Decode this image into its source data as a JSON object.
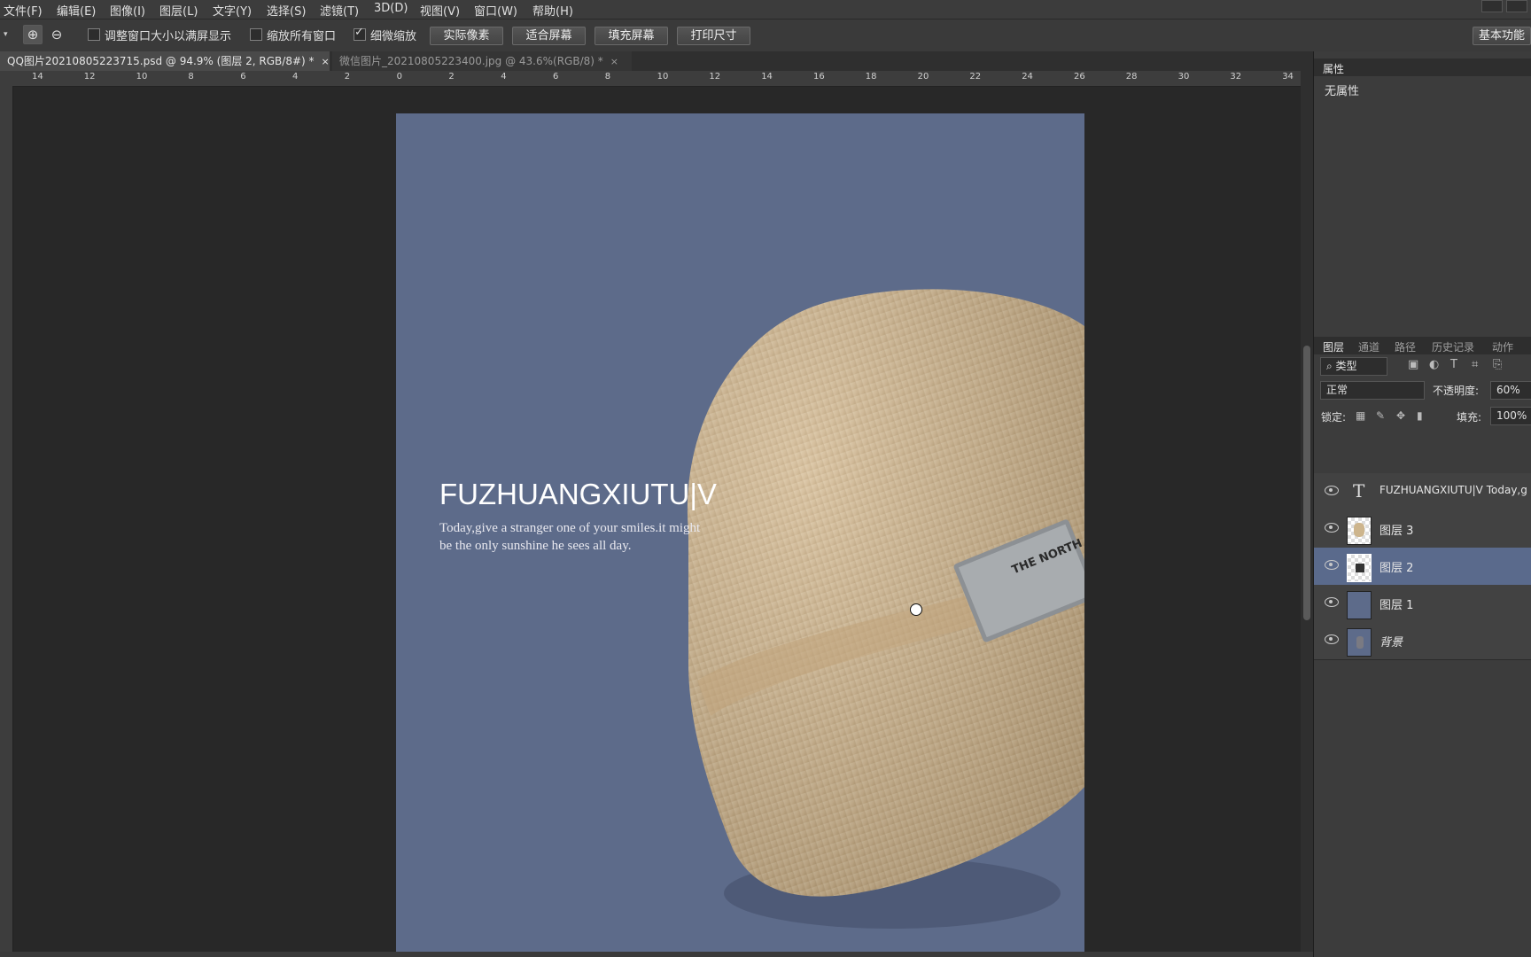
{
  "menu": [
    "文件(F)",
    "编辑(E)",
    "图像(I)",
    "图层(L)",
    "文字(Y)",
    "选择(S)",
    "滤镜(T)",
    "3D(D)",
    "视图(V)",
    "窗口(W)",
    "帮助(H)"
  ],
  "options": {
    "resize_windows": "调整窗口大小以满屏显示",
    "zoom_all_windows": "缩放所有窗口",
    "scrubby_zoom": "细微缩放",
    "actual_pixels": "实际像素",
    "fit_screen": "适合屏幕",
    "fill_screen": "填充屏幕",
    "print_size": "打印尺寸",
    "workspace": "基本功能"
  },
  "tabs": [
    {
      "label": "QQ图片20210805223715.psd @ 94.9% (图层 2, RGB/8#) *",
      "close": "×"
    },
    {
      "label": "微信图片_20210805223400.jpg @ 43.6%(RGB/8) *",
      "close": "×"
    }
  ],
  "ruler": {
    "h": [
      "14",
      "12",
      "10",
      "8",
      "6",
      "4",
      "2",
      "0",
      "2",
      "4",
      "6",
      "8",
      "10",
      "12",
      "14",
      "16",
      "18",
      "20",
      "22",
      "24",
      "26",
      "28",
      "30",
      "32",
      "34"
    ]
  },
  "document": {
    "headline": "FUZHUANGXIUTU|V",
    "body_line1": "Today,give a stranger one of your smiles.it might",
    "body_line2": "be the only sunshine he sees all day.",
    "background": "#5d6b8a",
    "label_text": "THE NORTH FACE GUCCI"
  },
  "properties": {
    "tab": "属性",
    "empty": "无属性"
  },
  "layers_panel": {
    "tabs": [
      "图层",
      "通道",
      "路径",
      "历史记录",
      "动作"
    ],
    "filter": "类型",
    "blend_mode": "正常",
    "opacity_label": "不透明度:",
    "opacity_value": "60%",
    "lock_label": "锁定:",
    "fill_label": "填充:",
    "fill_value": "100%",
    "layers": [
      {
        "name": "FUZHUANGXIUTU|V Today,g",
        "type": "text"
      },
      {
        "name": "图层 3",
        "type": "image"
      },
      {
        "name": "图层 2",
        "type": "image"
      },
      {
        "name": "图层 1",
        "type": "fill"
      },
      {
        "name": "背景",
        "type": "background"
      }
    ]
  }
}
